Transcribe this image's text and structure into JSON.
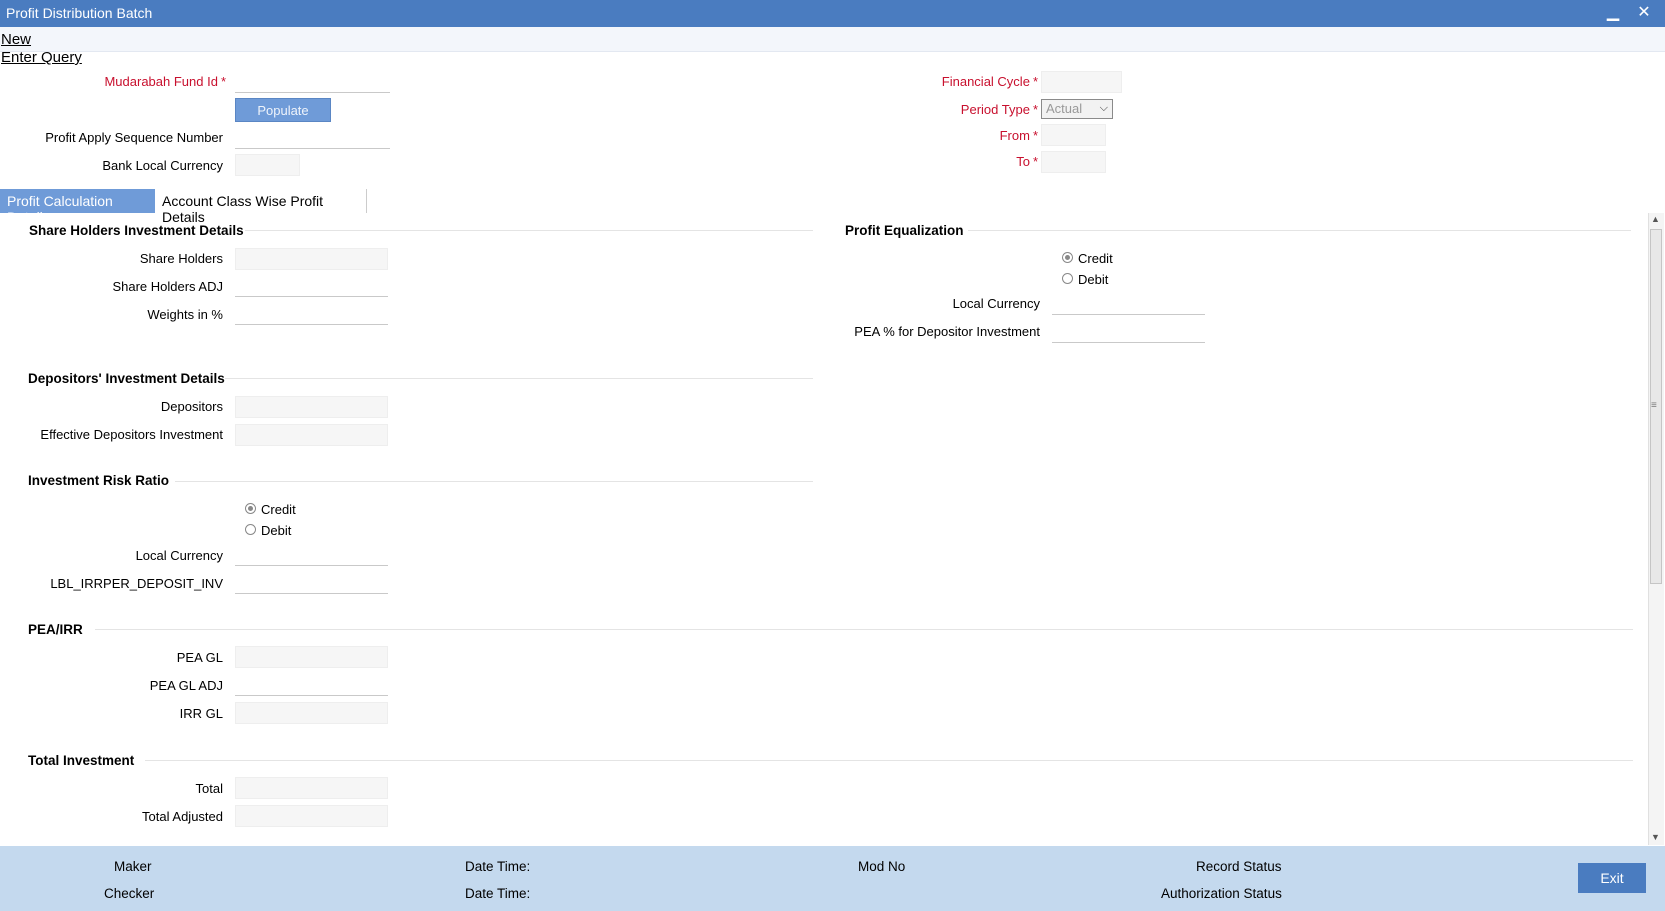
{
  "window": {
    "title": "Profit Distribution Batch",
    "minimize_glyph": "▁",
    "close_glyph": "✕"
  },
  "actions": {
    "new": "New",
    "enter_query": "Enter Query"
  },
  "header": {
    "mudarabah_fund_id": "Mudarabah Fund Id",
    "populate": "Populate",
    "profit_apply_seq": "Profit Apply Sequence Number",
    "bank_local_currency": "Bank Local Currency",
    "financial_cycle": "Financial Cycle",
    "period_type": "Period Type",
    "period_type_value": "Actual",
    "from": "From",
    "to": "To",
    "required_mark": "*"
  },
  "tabs": [
    {
      "label": "Profit Calculation Details",
      "active": true
    },
    {
      "label": "Account Class Wise Profit Details",
      "active": false
    }
  ],
  "shareholders": {
    "title": "Share Holders Investment Details",
    "share_holders": "Share Holders",
    "share_holders_adj": "Share Holders ADJ",
    "weights": "Weights in %"
  },
  "equalization": {
    "title": "Profit Equalization",
    "credit": "Credit",
    "debit": "Debit",
    "local_currency": "Local Currency",
    "pea_pct": "PEA % for Depositor Investment"
  },
  "depositors": {
    "title": "Depositors' Investment Details",
    "depositors": "Depositors",
    "effective": "Effective Depositors Investment"
  },
  "risk": {
    "title": "Investment Risk Ratio",
    "credit": "Credit",
    "debit": "Debit",
    "local_currency": "Local Currency",
    "irr_per": "LBL_IRRPER_DEPOSIT_INV"
  },
  "pea_irr": {
    "title": "PEA/IRR",
    "pea_gl": "PEA GL",
    "pea_gl_adj": "PEA GL ADJ",
    "irr_gl": "IRR GL"
  },
  "total": {
    "title": "Total Investment",
    "total": "Total",
    "total_adjusted": "Total Adjusted"
  },
  "footer": {
    "maker": "Maker",
    "checker": "Checker",
    "date_time": "Date Time:",
    "mod_no": "Mod No",
    "record_status": "Record Status",
    "authorization_status": "Authorization Status",
    "exit": "Exit"
  },
  "colors": {
    "titlebar": "#4a7cc0",
    "required": "#c8102e",
    "footer": "#c4d9ee",
    "active_tab": "#6f9bd8"
  }
}
